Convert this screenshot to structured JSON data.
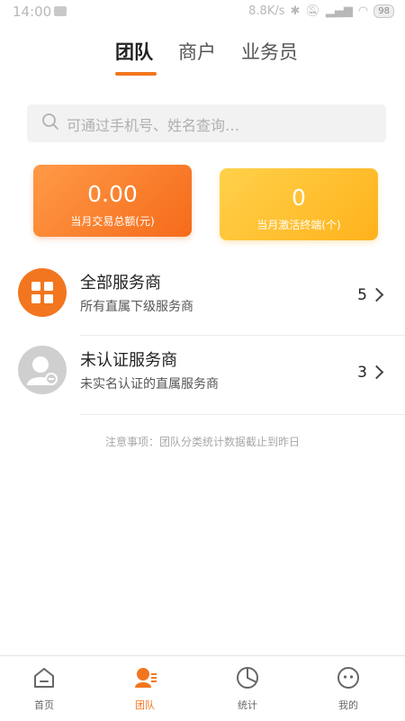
{
  "status_bar": {
    "time": "14:00",
    "net_speed": "8.8K/s",
    "battery": "98"
  },
  "tabs": [
    {
      "label": "团队",
      "active": true
    },
    {
      "label": "商户",
      "active": false
    },
    {
      "label": "业务员",
      "active": false
    }
  ],
  "search": {
    "placeholder": "可通过手机号、姓名查询…"
  },
  "cards": [
    {
      "value": "0.00",
      "label": "当月交易总额(元)",
      "color": "#f5781f"
    },
    {
      "value": "0",
      "label": "当月激活终端(个)",
      "color": "#ffbf2a"
    }
  ],
  "list": [
    {
      "title": "全部服务商",
      "subtitle": "所有直属下级服务商",
      "count": "5",
      "icon": "grid-icon"
    },
    {
      "title": "未认证服务商",
      "subtitle": "未实名认证的直属服务商",
      "count": "3",
      "icon": "user-avatar-icon"
    }
  ],
  "note": "注意事项：团队分类统计数据截止到昨日",
  "bottom_nav": [
    {
      "label": "首页",
      "icon": "home-icon",
      "active": false
    },
    {
      "label": "团队",
      "icon": "team-icon",
      "active": true
    },
    {
      "label": "统计",
      "icon": "pie-chart-icon",
      "active": false
    },
    {
      "label": "我的",
      "icon": "profile-icon",
      "active": false
    }
  ],
  "colors": {
    "accent": "#f2761f",
    "yellow": "#ffb21c"
  }
}
